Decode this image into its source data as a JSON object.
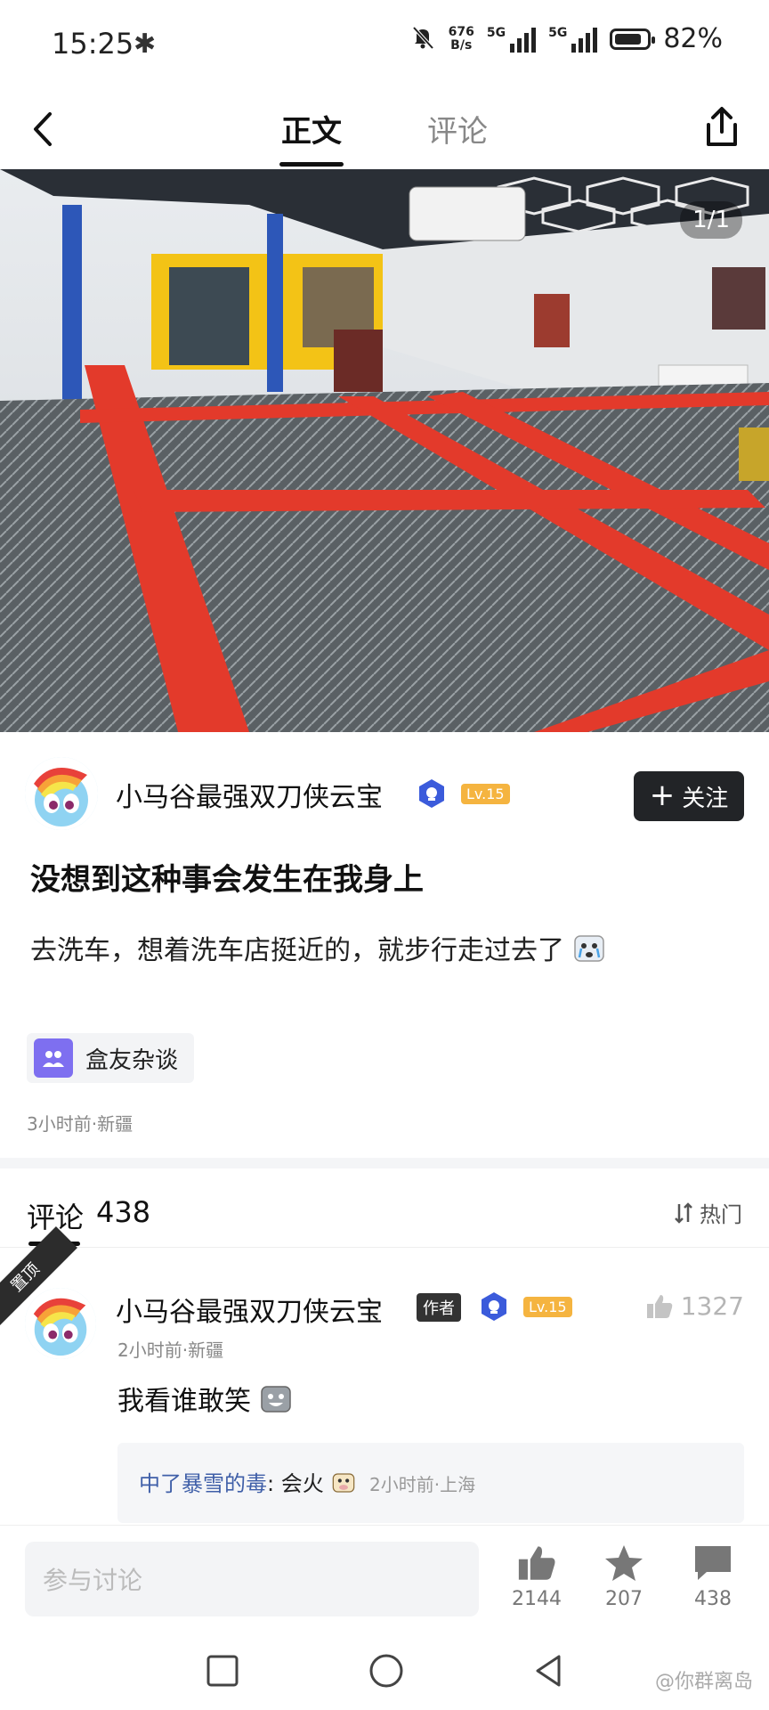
{
  "status_bar": {
    "time": "15:25",
    "net_speed_value": "676",
    "net_speed_unit": "B/s",
    "sim1": "5G",
    "sim2": "5G",
    "battery": "82%"
  },
  "nav": {
    "tab_article": "正文",
    "tab_comments": "评论"
  },
  "hero": {
    "counter": "1/1"
  },
  "author": {
    "name": "小马谷最强双刀侠云宝",
    "level": "Lv.15",
    "follow_label": "关注"
  },
  "post": {
    "title": "没想到这种事会发生在我身上",
    "body": "去洗车，想着洗车店挺近的，就步行走过去了",
    "topic": "盒友杂谈",
    "meta": "3小时前·新疆"
  },
  "comments": {
    "title": "评论",
    "count": "438",
    "sort_label": "热门",
    "pinned_label": "置顶",
    "top": {
      "name": "小马谷最强双刀侠云宝",
      "author_tag": "作者",
      "level": "Lv.15",
      "likes": "1327",
      "meta": "2小时前·新疆",
      "text": "我看谁敢笑",
      "reply": {
        "user": "中了暴雪的毒",
        "text": ": 会火",
        "time": "2小时前·上海"
      }
    }
  },
  "bottom_bar": {
    "input_placeholder": "参与讨论",
    "likes": "2144",
    "favorites": "207",
    "comments": "438"
  },
  "watermark": "@你群离岛",
  "colors": {
    "follow_bg": "#222427",
    "level_badge": "#f5b440",
    "verify_badge": "#3b5bdb",
    "reply_user": "#3f5fa8",
    "topic_icon": "#7e6ff0"
  }
}
